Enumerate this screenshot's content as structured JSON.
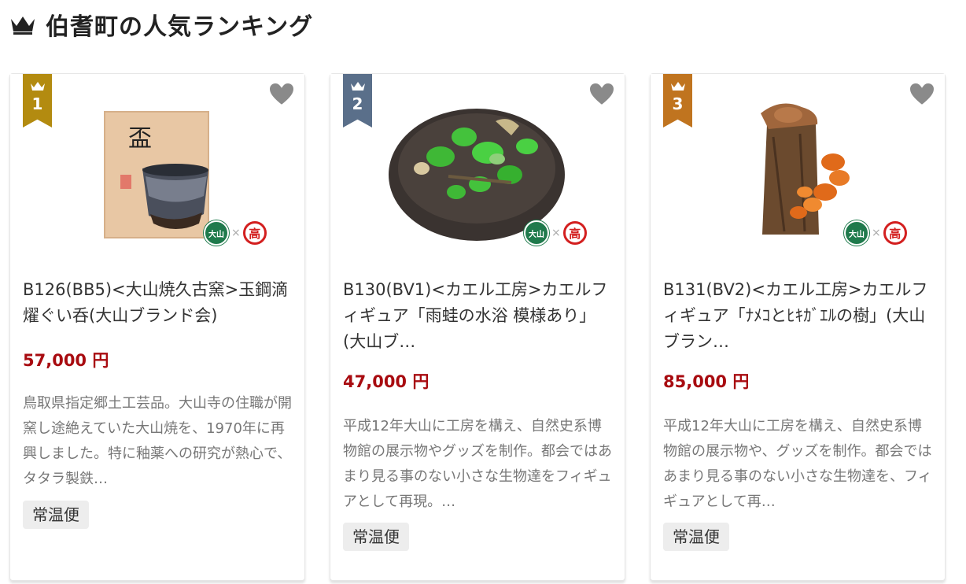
{
  "section": {
    "title": "伯耆町の人気ランキング",
    "icon": "crown-icon"
  },
  "colors": {
    "rank1": "#b38b10",
    "rank2": "#5a6f8a",
    "rank3": "#c0741f",
    "price": "#a80b10"
  },
  "cards": [
    {
      "rank": "1",
      "name": "B126(BB5)<大山焼久古窯>玉鋼滴燿ぐい呑(大山ブランド会)",
      "price": "57,000 円",
      "description": "鳥取県指定郷土工芸品。大山寺の住職が開窯し途絶えていた大山焼を、1970年に再興しました。特に釉薬への研究が熱心で、タタラ製鉄…",
      "tag": "常温便"
    },
    {
      "rank": "2",
      "name": "B130(BV1)<カエル工房>カエルフィギュア「雨蛙の水浴 模様あり」(大山ブ…",
      "price": "47,000 円",
      "description": "平成12年大山に工房を構え、自然史系博物館の展示物やグッズを制作。都会ではあまり見る事のない小さな生物達をフィギュアとして再現。…",
      "tag": "常温便"
    },
    {
      "rank": "3",
      "name": "B131(BV2)<カエル工房>カエルフィギュア「ﾅﾒｺとﾋｷｶﾞｴﾙの樹」(大山ブラン…",
      "price": "85,000 円",
      "description": "平成12年大山に工房を構え、自然史系博物館の展示物や、グッズを制作。都会ではあまり見る事のない小さな生物達を、フィギュアとして再…",
      "tag": "常温便"
    }
  ],
  "brand_logos": {
    "left": "大山",
    "separator": "×",
    "right": "高"
  }
}
